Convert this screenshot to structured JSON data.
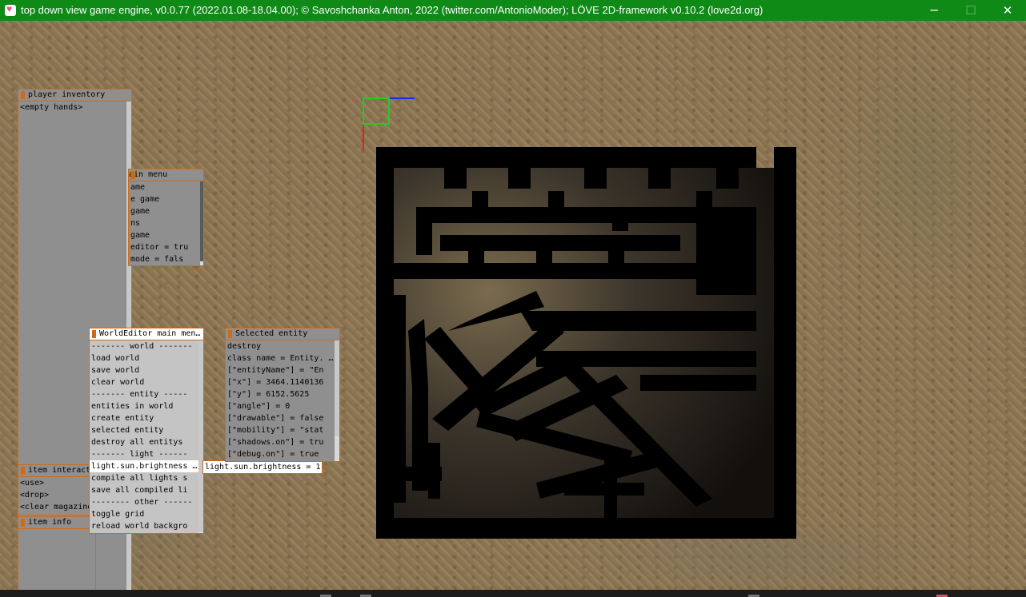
{
  "window": {
    "title": "top down view game engine, v0.0.77 (2022.01.08-18.04.00); © Savoshchanka Anton, 2022 (twitter.com/AntonioModer); LÖVE 2D-framework v0.10.2 (love2d.org)",
    "minimize": "─",
    "maximize": "☐",
    "close": "✕"
  },
  "colors": {
    "titlebar": "#0f8a17",
    "panel_accent": "#d06a18",
    "panel_bg": "#8f8f8f"
  },
  "player_inventory": {
    "title": "player inventory",
    "rows": [
      "<empty hands>"
    ]
  },
  "main_menu": {
    "title": "ain menu",
    "rows": [
      "ame",
      "e game",
      "game",
      "ns",
      "game",
      "editor = tru",
      "mode = fals"
    ]
  },
  "item_interact": {
    "title": "item interact",
    "rows": [
      "<use>",
      "<drop>",
      "<clear magazine"
    ]
  },
  "item_info": {
    "title": "item info"
  },
  "world_editor": {
    "title": "WorldEditor main men…",
    "rows": [
      "------- world -------",
      "load world",
      "save world",
      "clear world",
      "------- entity -----",
      "entities in world",
      "create entity",
      "selected entity",
      "destroy all entitys",
      "------- light ------",
      "light.sun.brightness …",
      "compile all lights s",
      "save all compiled li",
      "-------- other ------",
      "toggle grid",
      "reload world backgro"
    ],
    "selected_index": 10
  },
  "tooltip": {
    "text": "light.sun.brightness = 1"
  },
  "selected_entity": {
    "title": "Selected entity",
    "rows": [
      "destroy",
      "class name = Entity. …",
      "[\"entityName\"] = \"En",
      "[\"x\"] = 3464.1140136",
      "[\"y\"] = 6152.5625",
      "[\"angle\"] = 0",
      "[\"drawable\"] = false",
      "[\"mobility\"] = \"stat",
      "[\"shadows.on\"] = tru",
      "[\"debug.on\"] = true"
    ]
  }
}
